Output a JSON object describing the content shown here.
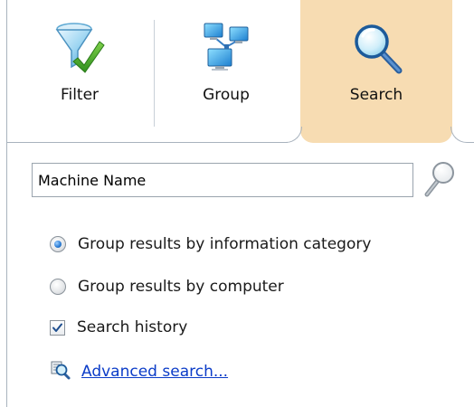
{
  "tabs": [
    {
      "label": "Filter",
      "icon": "funnel-checkmark-icon",
      "selected": false
    },
    {
      "label": "Group",
      "icon": "networked-computers-icon",
      "selected": false
    },
    {
      "label": "Search",
      "icon": "magnifier-icon",
      "selected": true
    }
  ],
  "search": {
    "value": "Machine Name",
    "go_icon": "magnifier-icon"
  },
  "options": {
    "group_by_category": {
      "label": "Group results by information category",
      "checked": true
    },
    "group_by_computer": {
      "label": "Group results by computer",
      "checked": false
    },
    "search_history": {
      "label": "Search history",
      "checked": true
    }
  },
  "advanced": {
    "label": "Advanced search...",
    "icon": "advanced-search-icon"
  },
  "colors": {
    "selected_tab_bg": "#f7dcb2",
    "link": "#0b3cc8",
    "border": "#a9b3be"
  }
}
